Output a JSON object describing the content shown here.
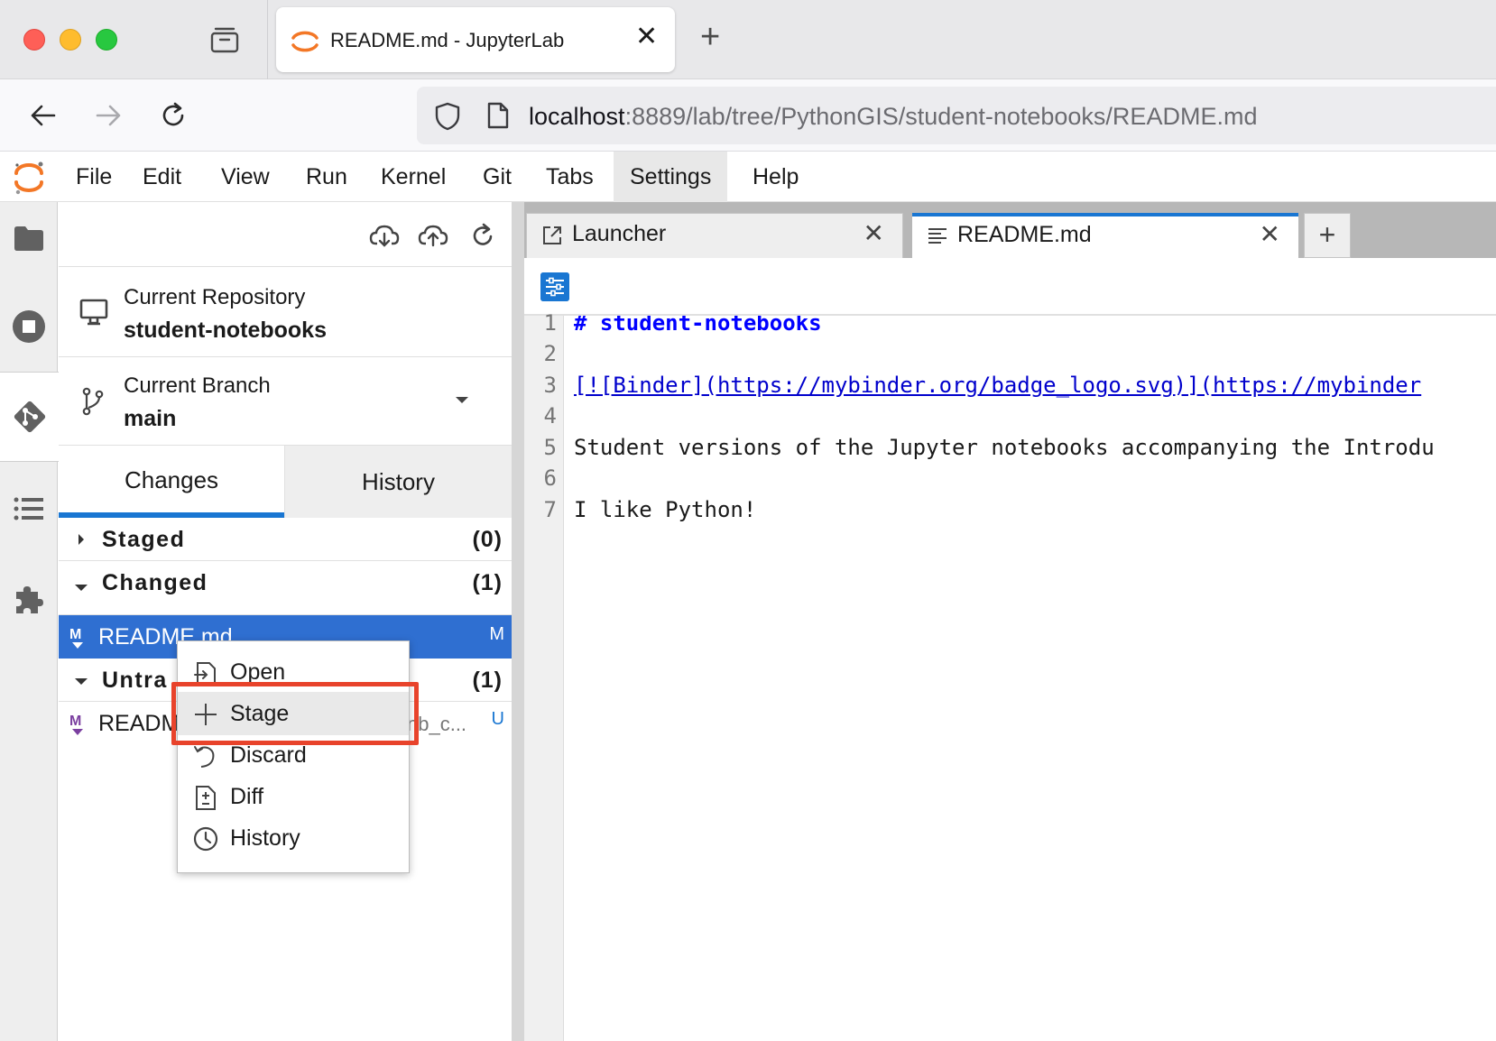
{
  "browser": {
    "tab_title": "README.md - JupyterLab",
    "tab_close": "✕",
    "new_tab": "+",
    "url_host": "localhost",
    "url_path": ":8889/lab/tree/PythonGIS/student-notebooks/README.md"
  },
  "menubar": {
    "items": [
      "File",
      "Edit",
      "View",
      "Run",
      "Kernel",
      "Git",
      "Tabs",
      "Settings",
      "Help"
    ],
    "active": "Settings"
  },
  "git_panel": {
    "repo_label": "Current Repository",
    "repo_name": "student-notebooks",
    "branch_label": "Current Branch",
    "branch_name": "main",
    "tabs": [
      "Changes",
      "History"
    ],
    "active_tab": "Changes",
    "sections": [
      {
        "title": "Staged",
        "count": "(0)",
        "expanded": false
      },
      {
        "title": "Changed",
        "count": "(1)",
        "expanded": true
      },
      {
        "title": "Untra",
        "count": "(1)",
        "expanded": true
      }
    ],
    "changed_file": {
      "name": "README.md",
      "status": "M",
      "icon": "M"
    },
    "untracked_file": {
      "name": "READM",
      "tail": "nb_c...",
      "status": "U",
      "icon": "M"
    }
  },
  "dock": {
    "tabs": [
      {
        "label": "Launcher",
        "icon": "launcher-icon"
      },
      {
        "label": "README.md",
        "icon": "text-file-icon",
        "active": true
      }
    ],
    "add_tab": "+",
    "close": "✕"
  },
  "editor": {
    "line_numbers": [
      "1",
      "2",
      "3",
      "4",
      "5",
      "6",
      "7"
    ],
    "lines": [
      "# student-notebooks",
      "",
      "[![Binder](https://mybinder.org/badge_logo.svg)](https://mybinder",
      "",
      "Student versions of the Jupyter notebooks accompanying the Introdu",
      "",
      "I like Python!"
    ]
  },
  "context_menu": {
    "items": [
      {
        "label": "Open",
        "icon": "open-icon"
      },
      {
        "label": "Stage",
        "icon": "plus-icon",
        "highlighted": true
      },
      {
        "label": "Discard",
        "icon": "discard-icon"
      },
      {
        "label": "Diff",
        "icon": "diff-icon"
      },
      {
        "label": "History",
        "icon": "clock-icon"
      }
    ]
  },
  "colors": {
    "accent": "#1976d2",
    "selected_row": "#2f6fd1",
    "highlight": "#e8432b",
    "jupyter_orange": "#f37726"
  }
}
